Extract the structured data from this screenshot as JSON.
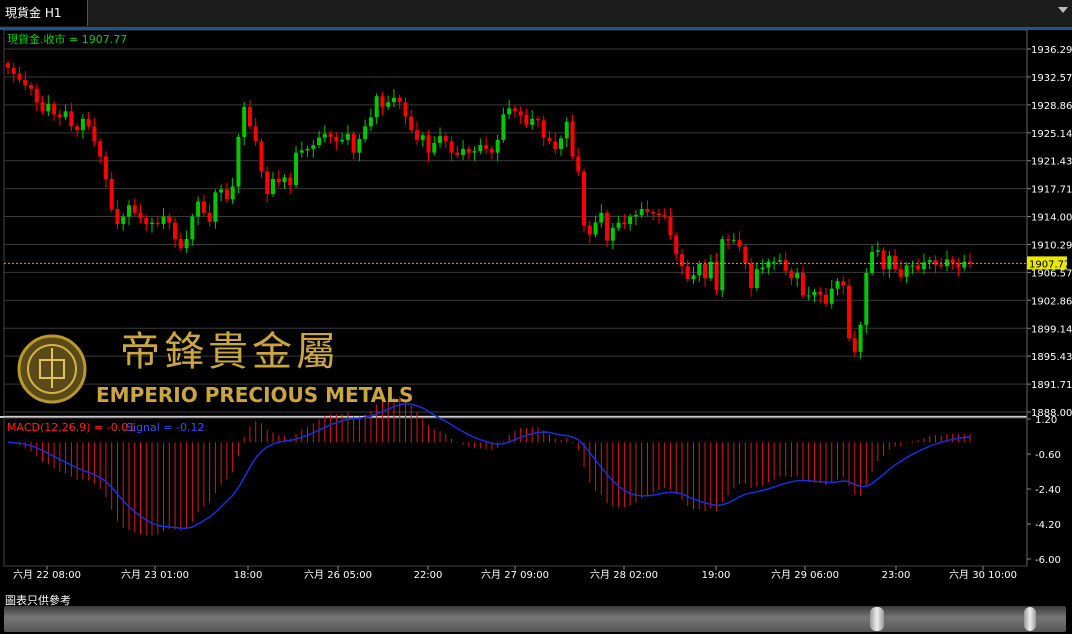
{
  "tab": {
    "label": "現貨金 H1"
  },
  "price_header": {
    "text": "現貨金.收市 = 1907.77"
  },
  "macd_header": {
    "macd_label": "MACD(12,26,9) = -0.01",
    "signal_label": "Signal = -0.12"
  },
  "logo": {
    "chinese": "帝鋒貴金屬",
    "english": "EMPERIO PRECIOUS METALS"
  },
  "footer_note": "圖表只供參考",
  "colors": {
    "up": "#00c800",
    "down": "#ff0000",
    "macd_hist": "#d81a1a",
    "signal": "#1a2fd8",
    "axis_text": "#e8c800",
    "grid": "#3a3a3a",
    "last_price_bg": "#e8e800"
  },
  "chart_data": [
    {
      "type": "candlestick",
      "title": "現貨金 H1",
      "ylim": [
        1888.0,
        1936.29
      ],
      "y_ticks": [
        "1936.29",
        "1932.57",
        "1928.86",
        "1925.14",
        "1921.43",
        "1917.71",
        "1914.00",
        "1910.29",
        "1906.57",
        "1902.86",
        "1899.14",
        "1895.43",
        "1891.71",
        "1888.00"
      ],
      "x_ticks": [
        "六月 22 08:00",
        "六月 23 01:00",
        "18:00",
        "六月 26 05:00",
        "22:00",
        "六月 27 09:00",
        "六月 28 02:00",
        "19:00",
        "六月 29 06:00",
        "23:00",
        "六月 30 10:00"
      ],
      "last_price": 1907.77,
      "last_price_label": "1907.77",
      "close_series": [
        1933.8,
        1933.0,
        1932.2,
        1931.5,
        1931.0,
        1929.2,
        1928.0,
        1929.0,
        1927.6,
        1927.2,
        1928.0,
        1926.0,
        1925.5,
        1927.0,
        1926.0,
        1924.0,
        1922.0,
        1919.0,
        1915.0,
        1913.0,
        1914.0,
        1915.5,
        1914.5,
        1913.8,
        1913.0,
        1913.2,
        1913.0,
        1914.0,
        1913.2,
        1911.0,
        1909.8,
        1911.0,
        1914.0,
        1916.0,
        1914.5,
        1913.3,
        1917.2,
        1917.6,
        1916.3,
        1918.0,
        1924.6,
        1928.6,
        1926.0,
        1924.0,
        1920.0,
        1917.0,
        1919.0,
        1918.6,
        1919.2,
        1918.2,
        1922.5,
        1922.8,
        1923.0,
        1923.5,
        1924.5,
        1925.0,
        1924.6,
        1924.0,
        1924.2,
        1925.0,
        1922.5,
        1924.3,
        1926.0,
        1927.2,
        1930.0,
        1928.6,
        1929.2,
        1929.8,
        1929.2,
        1927.3,
        1925.5,
        1924.2,
        1924.8,
        1922.5,
        1923.8,
        1924.7,
        1924.0,
        1922.5,
        1922.2,
        1923.0,
        1922.5,
        1922.7,
        1923.5,
        1923.0,
        1922.5,
        1924.2,
        1927.6,
        1928.4,
        1928.0,
        1927.5,
        1926.2,
        1927.0,
        1926.8,
        1924.5,
        1924.0,
        1923.0,
        1924.4,
        1926.6,
        1922.0,
        1920.0,
        1912.8,
        1911.6,
        1913.2,
        1914.5,
        1910.8,
        1912.5,
        1913.2,
        1913.0,
        1914.0,
        1914.2,
        1915.0,
        1914.6,
        1914.4,
        1914.2,
        1914.0,
        1911.5,
        1909.0,
        1907.4,
        1905.7,
        1906.2,
        1907.7,
        1905.8,
        1908.0,
        1904.2,
        1911.0,
        1910.8,
        1910.9,
        1910.0,
        1907.8,
        1904.5,
        1907.0,
        1907.2,
        1908.0,
        1908.0,
        1908.2,
        1906.8,
        1905.8,
        1906.5,
        1903.5,
        1903.5,
        1904.0,
        1903.6,
        1902.4,
        1904.4,
        1905.4,
        1904.8,
        1897.8,
        1896.0,
        1899.6,
        1906.5,
        1909.3,
        1909.5,
        1907.0,
        1908.8,
        1907.0,
        1906.0,
        1907.5,
        1907.5,
        1907.0,
        1907.9,
        1908.2,
        1907.6,
        1907.4,
        1908.3,
        1907.8,
        1907.2,
        1908.0,
        1907.77
      ]
    },
    {
      "type": "bar",
      "title": "MACD(12,26,9)",
      "ylim": [
        -6.0,
        1.2
      ],
      "y_ticks": [
        "1.20",
        "-0.60",
        "-2.40",
        "-4.20",
        "-6.00"
      ],
      "macd_value": -0.01,
      "signal_value": -0.12
    }
  ]
}
